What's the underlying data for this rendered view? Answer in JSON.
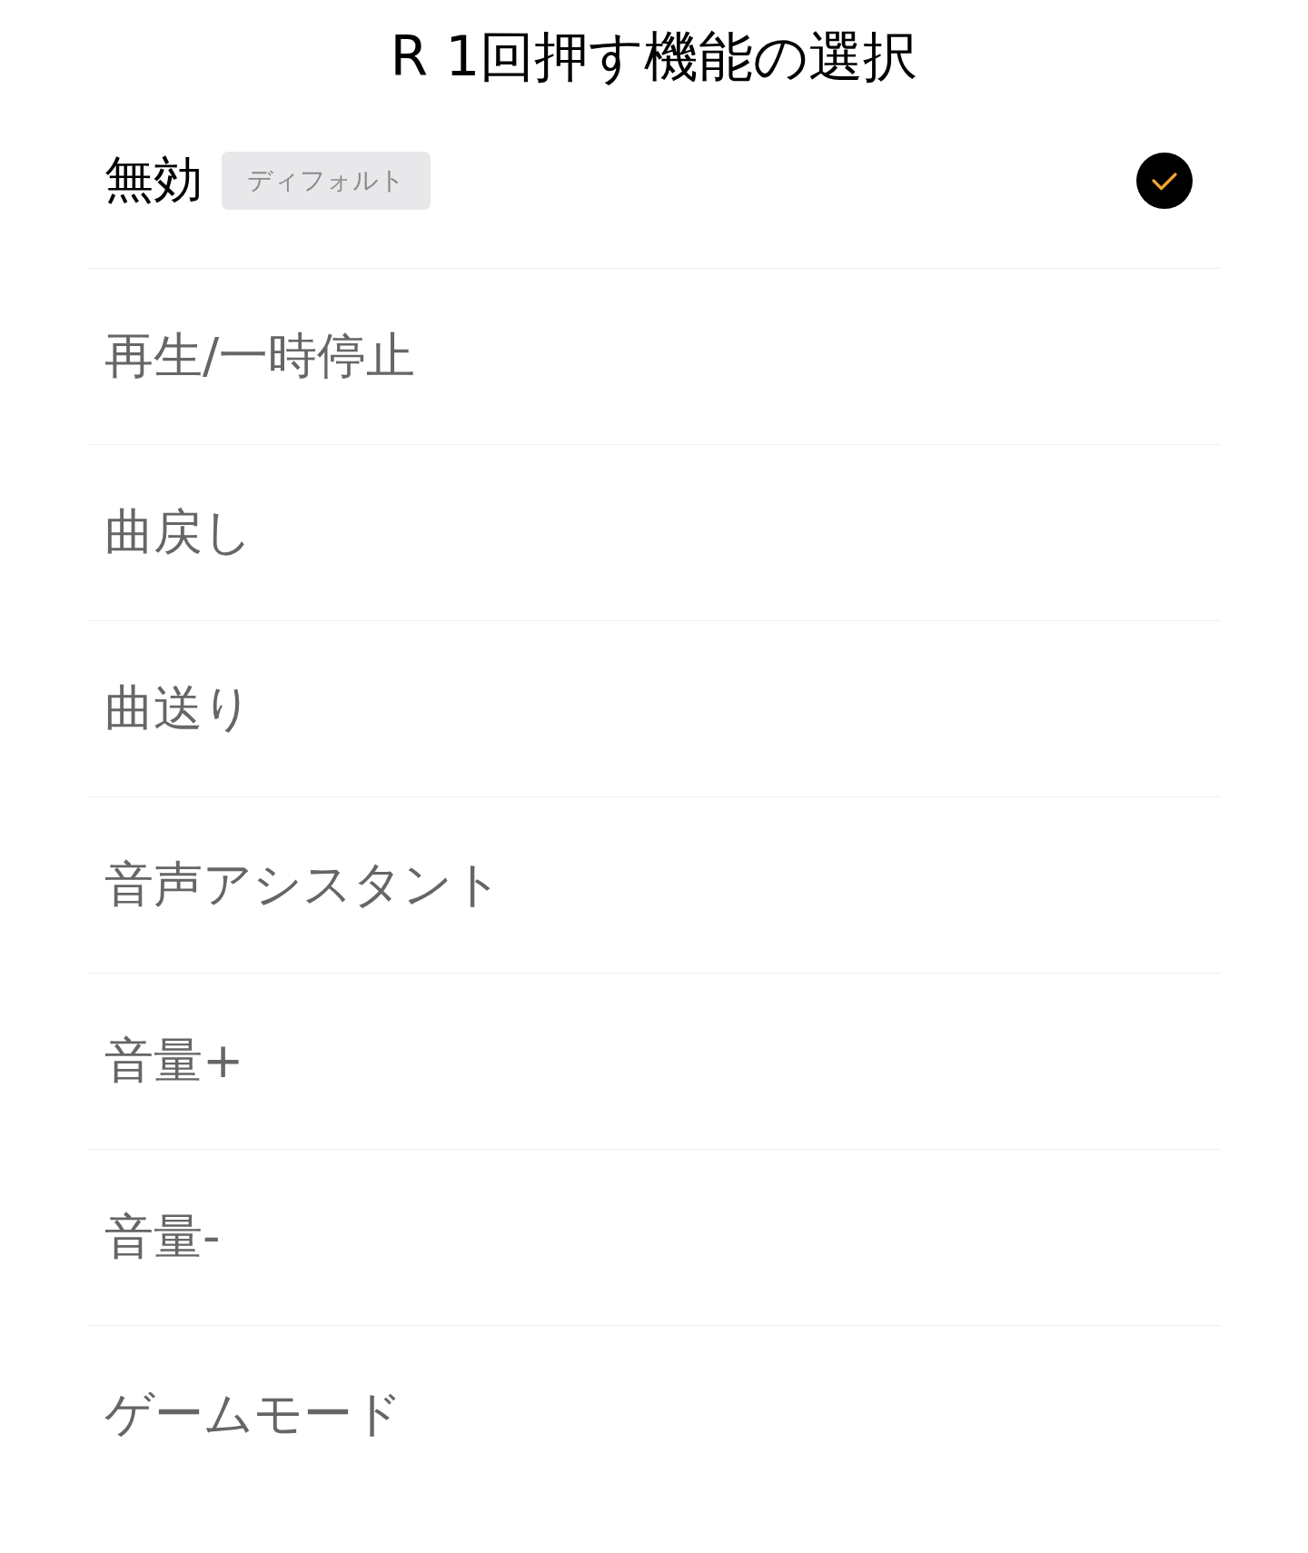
{
  "title": "R 1回押す機能の選択",
  "items": [
    {
      "label": "無効",
      "badge": "ディフォルト",
      "selected": true
    },
    {
      "label": "再生/一時停止",
      "selected": false
    },
    {
      "label": "曲戻し",
      "selected": false
    },
    {
      "label": "曲送り",
      "selected": false
    },
    {
      "label": "音声アシスタント",
      "selected": false
    },
    {
      "label": "音量+",
      "selected": false
    },
    {
      "label": "音量-",
      "selected": false
    },
    {
      "label": "ゲームモード",
      "selected": false
    }
  ]
}
